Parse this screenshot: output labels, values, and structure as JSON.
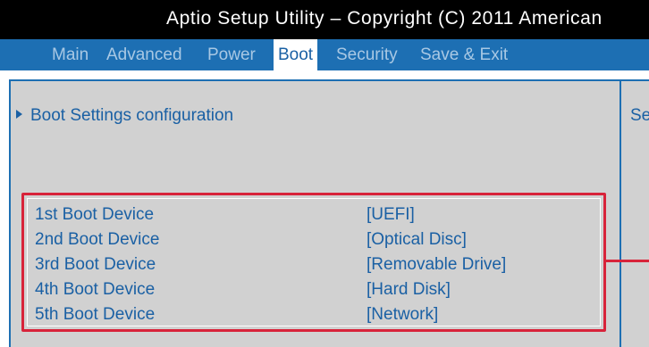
{
  "window": {
    "title": "Aptio Setup Utility – Copyright (C) 2011 American"
  },
  "tabs": [
    {
      "label": "Main",
      "active": false
    },
    {
      "label": "Advanced",
      "active": false
    },
    {
      "label": "Power",
      "active": false
    },
    {
      "label": "Boot",
      "active": true
    },
    {
      "label": "Security",
      "active": false
    },
    {
      "label": "Save & Exit",
      "active": false
    }
  ],
  "main": {
    "submenu_label": "Boot Settings configuration",
    "boot_devices": [
      {
        "label": "1st Boot Device",
        "value": "[UEFI]"
      },
      {
        "label": "2nd Boot Device",
        "value": "[Optical Disc]"
      },
      {
        "label": "3rd Boot Device",
        "value": "[Removable Drive]"
      },
      {
        "label": "4th Boot Device",
        "value": "[Hard Disk]"
      },
      {
        "label": "5th Boot Device",
        "value": "[Network]"
      }
    ]
  },
  "help_panel": {
    "text": "Se"
  },
  "colors": {
    "title_bg": "#000000",
    "tabbar_bg": "#1d6fb3",
    "content_bg": "#d1d1d1",
    "text": "#1a60a4",
    "highlight": "#d8233a"
  },
  "icons": {
    "submenu": "triangle-right-icon"
  }
}
